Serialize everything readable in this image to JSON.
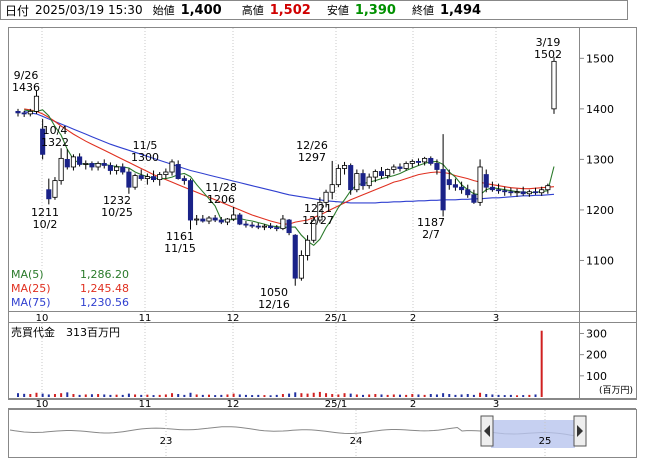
{
  "header": {
    "date_label": "日付",
    "datetime": "2025/03/19 15:30",
    "open_label": "始値",
    "open": "1,400",
    "high_label": "高値",
    "high": "1,502",
    "low_label": "安値",
    "low": "1,390",
    "close_label": "終値",
    "close": "1,494"
  },
  "colors": {
    "up": "#ffffff",
    "down": "#1a2288",
    "ma5": "#2a7a2a",
    "ma25": "#e03020",
    "ma75": "#3040d0",
    "volume": "#d02020",
    "volume_down": "#2030a0",
    "grid": "#c8c8c8"
  },
  "price_axis": {
    "ticks": [
      "1500",
      "1400",
      "1300",
      "1200",
      "1100"
    ]
  },
  "date_axis": {
    "ticks": [
      "10",
      "11",
      "12",
      "25/1",
      "2",
      "3"
    ]
  },
  "annotations": [
    {
      "lines": [
        "9/26",
        "1436"
      ]
    },
    {
      "lines": [
        "10/4",
        "1322"
      ]
    },
    {
      "lines": [
        "1211",
        "10/2"
      ]
    },
    {
      "lines": [
        "11/5",
        "1300"
      ]
    },
    {
      "lines": [
        "1232",
        "10/25"
      ]
    },
    {
      "lines": [
        "11/28",
        "1206"
      ]
    },
    {
      "lines": [
        "1161",
        "11/15"
      ]
    },
    {
      "lines": [
        "12/26",
        "1297"
      ]
    },
    {
      "lines": [
        "1221",
        "12/27"
      ]
    },
    {
      "lines": [
        "1050",
        "12/16"
      ]
    },
    {
      "lines": [
        "1187",
        "2/7"
      ]
    },
    {
      "lines": [
        "3/19",
        "1502"
      ]
    }
  ],
  "ma_legend": [
    {
      "label": "MA(5)",
      "value": "1,286.20"
    },
    {
      "label": "MA(25)",
      "value": "1,245.48"
    },
    {
      "label": "MA(75)",
      "value": "1,230.56"
    }
  ],
  "volume": {
    "title": "売買代金　313百万円",
    "ticks": [
      "300",
      "200",
      "100"
    ],
    "unit": "(百万円)"
  },
  "navigator": {
    "ticks": [
      "23",
      "24",
      "25"
    ],
    "left_handle_icon": "chevron-left-icon",
    "right_handle_icon": "chevron-right-icon"
  },
  "chart_data": {
    "type": "candlestick",
    "ylim": [
      1000,
      1560
    ],
    "candles": [
      {
        "o": 1395,
        "h": 1400,
        "l": 1385,
        "c": 1392
      },
      {
        "o": 1392,
        "h": 1396,
        "l": 1384,
        "c": 1390
      },
      {
        "o": 1390,
        "h": 1400,
        "l": 1385,
        "c": 1395
      },
      {
        "o": 1395,
        "h": 1436,
        "l": 1390,
        "c": 1425
      },
      {
        "o": 1360,
        "h": 1380,
        "l": 1300,
        "c": 1310
      },
      {
        "o": 1240,
        "h": 1262,
        "l": 1211,
        "c": 1222
      },
      {
        "o": 1225,
        "h": 1265,
        "l": 1220,
        "c": 1258
      },
      {
        "o": 1258,
        "h": 1322,
        "l": 1250,
        "c": 1302
      },
      {
        "o": 1300,
        "h": 1320,
        "l": 1280,
        "c": 1285
      },
      {
        "o": 1285,
        "h": 1310,
        "l": 1278,
        "c": 1305
      },
      {
        "o": 1305,
        "h": 1312,
        "l": 1286,
        "c": 1290
      },
      {
        "o": 1290,
        "h": 1298,
        "l": 1280,
        "c": 1292
      },
      {
        "o": 1292,
        "h": 1296,
        "l": 1278,
        "c": 1285
      },
      {
        "o": 1285,
        "h": 1296,
        "l": 1278,
        "c": 1292
      },
      {
        "o": 1292,
        "h": 1300,
        "l": 1282,
        "c": 1288
      },
      {
        "o": 1288,
        "h": 1294,
        "l": 1270,
        "c": 1278
      },
      {
        "o": 1278,
        "h": 1290,
        "l": 1270,
        "c": 1285
      },
      {
        "o": 1285,
        "h": 1292,
        "l": 1270,
        "c": 1275
      },
      {
        "o": 1275,
        "h": 1282,
        "l": 1232,
        "c": 1245
      },
      {
        "o": 1245,
        "h": 1272,
        "l": 1240,
        "c": 1268
      },
      {
        "o": 1268,
        "h": 1280,
        "l": 1258,
        "c": 1262
      },
      {
        "o": 1262,
        "h": 1272,
        "l": 1250,
        "c": 1266
      },
      {
        "o": 1266,
        "h": 1278,
        "l": 1255,
        "c": 1260
      },
      {
        "o": 1260,
        "h": 1275,
        "l": 1248,
        "c": 1270
      },
      {
        "o": 1270,
        "h": 1282,
        "l": 1262,
        "c": 1275
      },
      {
        "o": 1275,
        "h": 1300,
        "l": 1268,
        "c": 1295
      },
      {
        "o": 1290,
        "h": 1298,
        "l": 1260,
        "c": 1262
      },
      {
        "o": 1262,
        "h": 1268,
        "l": 1250,
        "c": 1258
      },
      {
        "o": 1258,
        "h": 1262,
        "l": 1161,
        "c": 1180
      },
      {
        "o": 1180,
        "h": 1190,
        "l": 1170,
        "c": 1182
      },
      {
        "o": 1182,
        "h": 1190,
        "l": 1175,
        "c": 1178
      },
      {
        "o": 1178,
        "h": 1188,
        "l": 1172,
        "c": 1184
      },
      {
        "o": 1184,
        "h": 1190,
        "l": 1176,
        "c": 1180
      },
      {
        "o": 1180,
        "h": 1186,
        "l": 1172,
        "c": 1176
      },
      {
        "o": 1176,
        "h": 1184,
        "l": 1170,
        "c": 1182
      },
      {
        "o": 1182,
        "h": 1206,
        "l": 1178,
        "c": 1190
      },
      {
        "o": 1190,
        "h": 1194,
        "l": 1170,
        "c": 1172
      },
      {
        "o": 1172,
        "h": 1178,
        "l": 1165,
        "c": 1170
      },
      {
        "o": 1170,
        "h": 1176,
        "l": 1164,
        "c": 1168
      },
      {
        "o": 1168,
        "h": 1174,
        "l": 1162,
        "c": 1166
      },
      {
        "o": 1166,
        "h": 1172,
        "l": 1160,
        "c": 1168
      },
      {
        "o": 1168,
        "h": 1174,
        "l": 1162,
        "c": 1165
      },
      {
        "o": 1165,
        "h": 1170,
        "l": 1158,
        "c": 1163
      },
      {
        "o": 1163,
        "h": 1190,
        "l": 1160,
        "c": 1182
      },
      {
        "o": 1180,
        "h": 1182,
        "l": 1150,
        "c": 1155
      },
      {
        "o": 1150,
        "h": 1152,
        "l": 1050,
        "c": 1065
      },
      {
        "o": 1065,
        "h": 1120,
        "l": 1060,
        "c": 1110
      },
      {
        "o": 1110,
        "h": 1150,
        "l": 1100,
        "c": 1140
      },
      {
        "o": 1140,
        "h": 1185,
        "l": 1135,
        "c": 1180
      },
      {
        "o": 1180,
        "h": 1225,
        "l": 1175,
        "c": 1215
      },
      {
        "o": 1215,
        "h": 1240,
        "l": 1205,
        "c": 1235
      },
      {
        "o": 1235,
        "h": 1297,
        "l": 1221,
        "c": 1250
      },
      {
        "o": 1250,
        "h": 1290,
        "l": 1245,
        "c": 1282
      },
      {
        "o": 1282,
        "h": 1295,
        "l": 1270,
        "c": 1288
      },
      {
        "o": 1288,
        "h": 1292,
        "l": 1230,
        "c": 1240
      },
      {
        "o": 1240,
        "h": 1280,
        "l": 1235,
        "c": 1272
      },
      {
        "o": 1272,
        "h": 1280,
        "l": 1240,
        "c": 1248
      },
      {
        "o": 1248,
        "h": 1272,
        "l": 1242,
        "c": 1265
      },
      {
        "o": 1265,
        "h": 1280,
        "l": 1255,
        "c": 1276
      },
      {
        "o": 1276,
        "h": 1285,
        "l": 1262,
        "c": 1268
      },
      {
        "o": 1268,
        "h": 1282,
        "l": 1262,
        "c": 1280
      },
      {
        "o": 1280,
        "h": 1290,
        "l": 1272,
        "c": 1285
      },
      {
        "o": 1285,
        "h": 1292,
        "l": 1276,
        "c": 1282
      },
      {
        "o": 1282,
        "h": 1296,
        "l": 1278,
        "c": 1292
      },
      {
        "o": 1292,
        "h": 1300,
        "l": 1284,
        "c": 1296
      },
      {
        "o": 1296,
        "h": 1302,
        "l": 1288,
        "c": 1295
      },
      {
        "o": 1295,
        "h": 1305,
        "l": 1288,
        "c": 1302
      },
      {
        "o": 1302,
        "h": 1306,
        "l": 1288,
        "c": 1292
      },
      {
        "o": 1292,
        "h": 1300,
        "l": 1270,
        "c": 1280
      },
      {
        "o": 1280,
        "h": 1350,
        "l": 1187,
        "c": 1200
      },
      {
        "o": 1260,
        "h": 1280,
        "l": 1240,
        "c": 1250
      },
      {
        "o": 1250,
        "h": 1262,
        "l": 1238,
        "c": 1245
      },
      {
        "o": 1245,
        "h": 1256,
        "l": 1232,
        "c": 1240
      },
      {
        "o": 1240,
        "h": 1250,
        "l": 1224,
        "c": 1230
      },
      {
        "o": 1230,
        "h": 1240,
        "l": 1212,
        "c": 1215
      },
      {
        "o": 1215,
        "h": 1300,
        "l": 1208,
        "c": 1285
      },
      {
        "o": 1270,
        "h": 1280,
        "l": 1235,
        "c": 1245
      },
      {
        "o": 1245,
        "h": 1256,
        "l": 1236,
        "c": 1240
      },
      {
        "o": 1240,
        "h": 1252,
        "l": 1232,
        "c": 1238
      },
      {
        "o": 1238,
        "h": 1246,
        "l": 1228,
        "c": 1236
      },
      {
        "o": 1236,
        "h": 1244,
        "l": 1228,
        "c": 1234
      },
      {
        "o": 1234,
        "h": 1242,
        "l": 1226,
        "c": 1236
      },
      {
        "o": 1236,
        "h": 1246,
        "l": 1228,
        "c": 1232
      },
      {
        "o": 1232,
        "h": 1240,
        "l": 1226,
        "c": 1236
      },
      {
        "o": 1236,
        "h": 1244,
        "l": 1230,
        "c": 1234
      },
      {
        "o": 1234,
        "h": 1246,
        "l": 1228,
        "c": 1240
      },
      {
        "o": 1240,
        "h": 1252,
        "l": 1232,
        "c": 1248
      },
      {
        "o": 1400,
        "h": 1502,
        "l": 1390,
        "c": 1494
      }
    ],
    "ma5": [
      1398,
      1396,
      1395,
      1398,
      1386,
      1365,
      1348,
      1320,
      1300,
      1292,
      1290,
      1291,
      1292,
      1290,
      1288,
      1286,
      1285,
      1283,
      1275,
      1270,
      1266,
      1263,
      1262,
      1262,
      1265,
      1270,
      1272,
      1266,
      1250,
      1236,
      1222,
      1208,
      1180,
      1180,
      1181,
      1183,
      1180,
      1178,
      1175,
      1172,
      1168,
      1167,
      1165,
      1166,
      1166,
      1150,
      1138,
      1130,
      1142,
      1165,
      1183,
      1205,
      1220,
      1238,
      1250,
      1252,
      1255,
      1258,
      1262,
      1265,
      1268,
      1272,
      1278,
      1283,
      1288,
      1292,
      1295,
      1296,
      1290,
      1275,
      1265,
      1250,
      1240,
      1232,
      1230,
      1240,
      1244,
      1242,
      1240,
      1238,
      1236,
      1235,
      1234,
      1235,
      1236,
      1238,
      1286
    ],
    "ma25": [
      1400,
      1398,
      1395,
      1390,
      1383,
      1375,
      1366,
      1358,
      1350,
      1343,
      1336,
      1330,
      1324,
      1318,
      1312,
      1306,
      1300,
      1294,
      1288,
      1282,
      1276,
      1270,
      1265,
      1260,
      1255,
      1250,
      1245,
      1240,
      1235,
      1230,
      1225,
      1220,
      1215,
      1210,
      1205,
      1200,
      1195,
      1190,
      1186,
      1182,
      1178,
      1175,
      1172,
      1172,
      1176,
      1178,
      1180,
      1185,
      1190,
      1196,
      1202,
      1208,
      1214,
      1220,
      1225,
      1230,
      1235,
      1240,
      1245,
      1250,
      1255,
      1258,
      1262,
      1266,
      1270,
      1272,
      1274,
      1275,
      1274,
      1272,
      1268,
      1265,
      1262,
      1258,
      1255,
      1252,
      1250,
      1248,
      1246,
      1244,
      1243,
      1242,
      1242,
      1243,
      1244,
      1245,
      1246
    ],
    "ma75": [
      1395,
      1392,
      1390,
      1385,
      1380,
      1375,
      1370,
      1365,
      1360,
      1355,
      1350,
      1345,
      1340,
      1335,
      1330,
      1326,
      1322,
      1318,
      1314,
      1310,
      1306,
      1302,
      1298,
      1294,
      1290,
      1286,
      1282,
      1278,
      1275,
      1272,
      1269,
      1266,
      1263,
      1260,
      1257,
      1254,
      1251,
      1248,
      1245,
      1242,
      1239,
      1236,
      1233,
      1230,
      1228,
      1226,
      1224,
      1222,
      1220,
      1218,
      1217,
      1216,
      1215,
      1214,
      1214,
      1214,
      1214,
      1214,
      1215,
      1215,
      1216,
      1216,
      1217,
      1217,
      1218,
      1218,
      1219,
      1219,
      1220,
      1220,
      1220,
      1221,
      1221,
      1222,
      1222,
      1223,
      1224,
      1224,
      1225,
      1226,
      1227,
      1228,
      1228,
      1229,
      1229,
      1230,
      1231
    ],
    "volumes": [
      18,
      15,
      14,
      20,
      16,
      12,
      14,
      18,
      22,
      14,
      10,
      12,
      13,
      14,
      12,
      10,
      11,
      10,
      16,
      12,
      10,
      11,
      9,
      10,
      12,
      18,
      14,
      10,
      20,
      12,
      10,
      11,
      9,
      10,
      12,
      16,
      12,
      10,
      9,
      10,
      9,
      8,
      10,
      14,
      16,
      22,
      18,
      16,
      20,
      24,
      18,
      14,
      12,
      18,
      16,
      12,
      10,
      12,
      14,
      12,
      10,
      12,
      11,
      10,
      14,
      12,
      10,
      14,
      12,
      18,
      14,
      10,
      12,
      14,
      10,
      20,
      14,
      12,
      10,
      9,
      10,
      8,
      9,
      10,
      12,
      313
    ]
  }
}
